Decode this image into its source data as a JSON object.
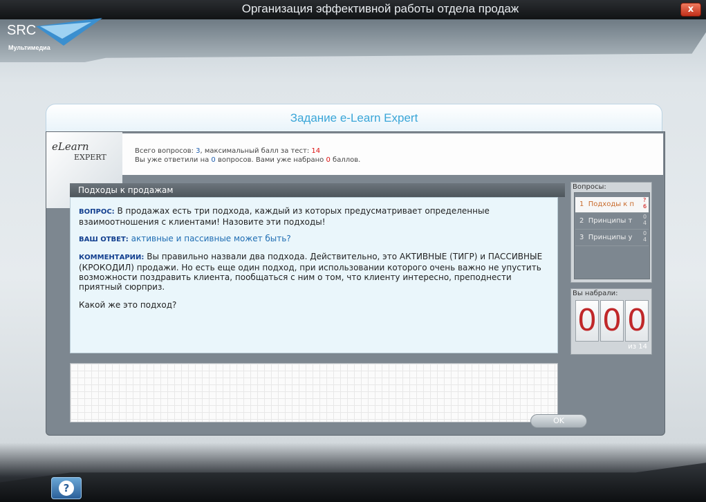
{
  "window": {
    "title": "Организация эффективной работы отдела продаж",
    "close_label": "x"
  },
  "logo": {
    "brand": "SRC",
    "subtitle": "Мультимедиа"
  },
  "panel": {
    "title": "Задание e-Learn Expert",
    "elogo_top": "eLearn",
    "elogo_bottom": "EXPERT"
  },
  "info": {
    "line1_prefix": "Всего вопросов: ",
    "total_questions": "3",
    "line1_mid": ", максимальный балл за тест: ",
    "max_score": "14",
    "line2_prefix": "Вы уже ответили на ",
    "answered": "0",
    "line2_mid": " вопросов. Вами уже набрано ",
    "points": "0",
    "line2_suffix": " баллов."
  },
  "question": {
    "header": "Подходы к продажам",
    "q_label": "ВОПРОС:",
    "q_text": "В продажах есть три подхода, каждый из которых предусматривает определенные взаимоотношения с клиентами! Назовите эти подходы!",
    "a_label": "ВАШ ОТВЕТ:",
    "a_text": "активные и пассивные может быть?",
    "c_label": "КОММЕНТАРИИ:",
    "c_text": "Вы правильно назвали два подхода. Действительно, это АКТИВНЫЕ (ТИГР) и ПАССИВНЫЕ (КРОКОДИЛ) продажи. Но есть еще один подход, при использовании которого очень важно не упустить возможности поздравить клиента, пообщаться с ним о том, что клиенту интересно, преподнести приятный сюрприз.",
    "followup": "Какой же это подход?"
  },
  "ok_label": "OK",
  "questions_panel": {
    "label": "Вопросы:",
    "items": [
      {
        "num": "1",
        "label": "Подходы к п",
        "score_top": "?",
        "score_bottom": "6"
      },
      {
        "num": "2",
        "label": "Принципы т",
        "score_top": "0",
        "score_bottom": "4"
      },
      {
        "num": "3",
        "label": "Принципы у",
        "score_top": "0",
        "score_bottom": "4"
      }
    ]
  },
  "score_panel": {
    "label": "Вы набрали:",
    "digits": [
      "0",
      "0",
      "0"
    ],
    "of_text": "из 14"
  },
  "help_label": "?",
  "colors": {
    "accent": "#3aa6d8",
    "label_blue": "#123f8f",
    "score_red": "#c0282a"
  }
}
